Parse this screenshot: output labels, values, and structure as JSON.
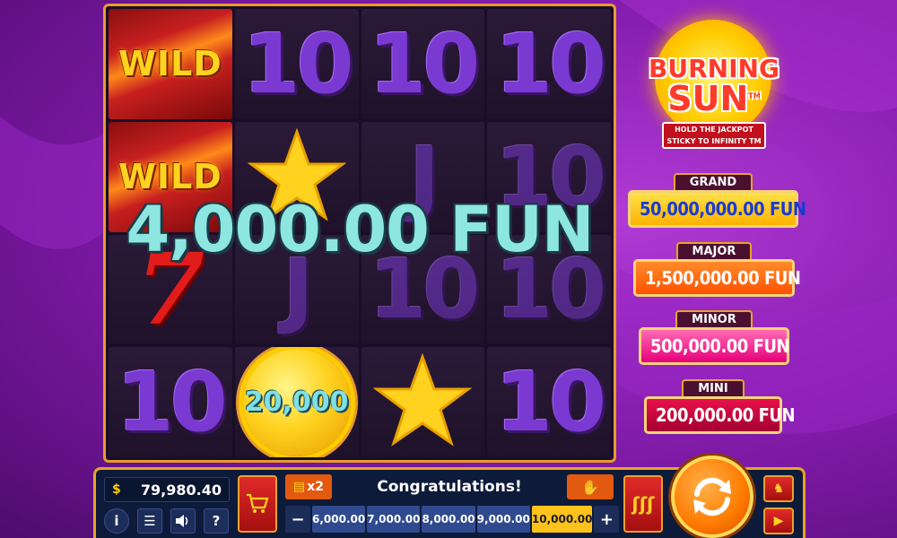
{
  "reels": [
    [
      {
        "type": "wild",
        "label": "WILD"
      },
      {
        "type": "text",
        "label": "10"
      },
      {
        "type": "text",
        "label": "10"
      },
      {
        "type": "text",
        "label": "10"
      }
    ],
    [
      {
        "type": "wild",
        "label": "WILD"
      },
      {
        "type": "star",
        "label": ""
      },
      {
        "type": "text",
        "label": "J"
      },
      {
        "type": "text",
        "label": "10"
      }
    ],
    [
      {
        "type": "seven",
        "label": "7"
      },
      {
        "type": "text",
        "label": "J"
      },
      {
        "type": "text",
        "label": "10"
      },
      {
        "type": "text",
        "label": "10"
      }
    ],
    [
      {
        "type": "text",
        "label": "10"
      },
      {
        "type": "coin",
        "label": "20,000"
      },
      {
        "type": "star",
        "label": ""
      },
      {
        "type": "text",
        "label": "10"
      }
    ]
  ],
  "win": {
    "amount": "4,000.00 FUN"
  },
  "logo": {
    "line1": "BURNING",
    "line2": "SUN",
    "tm": "TM",
    "sub1": "HOLD THE JACKPOT",
    "sub2": "STICKY TO INFINITY TM"
  },
  "jackpots": {
    "grand": {
      "label": "GRAND",
      "value": "50,000,000.00 FUN"
    },
    "major": {
      "label": "MAJOR",
      "value": "1,500,000.00 FUN"
    },
    "minor": {
      "label": "MINOR",
      "value": "500,000.00 FUN"
    },
    "mini": {
      "label": "MINI",
      "value": "200,000.00 FUN"
    }
  },
  "controls": {
    "balance": "79,980.40",
    "multiplier": "x2",
    "message": "Congratulations!",
    "help": "?",
    "info": "i",
    "minus": "−",
    "plus": "+",
    "bets": [
      "6,000.00",
      "7,000.00",
      "8,000.00",
      "9,000.00",
      "10,000.00"
    ],
    "selected_bet_index": 4
  },
  "colors": {
    "frame": "#e8a22c",
    "spin": "#ff7a00",
    "selected_bet": "#ffc21a"
  }
}
